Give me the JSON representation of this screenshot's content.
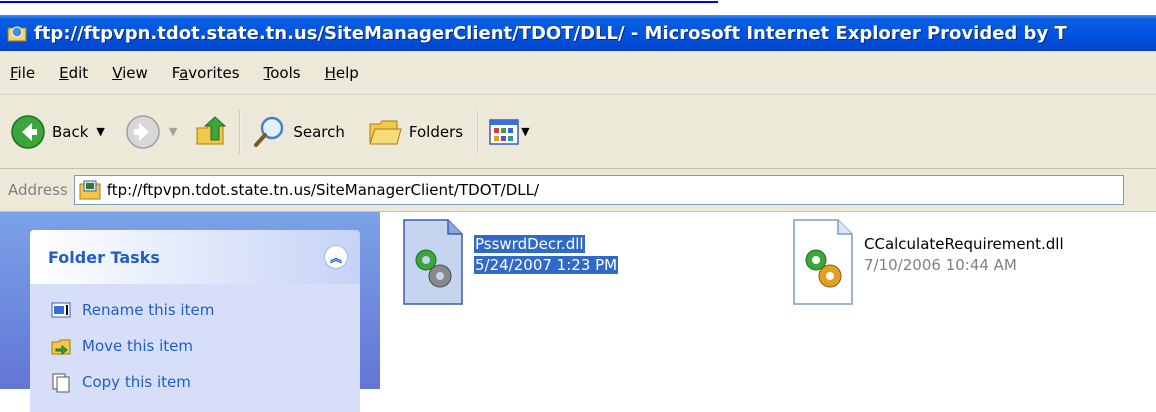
{
  "window": {
    "title": "ftp://ftpvpn.tdot.state.tn.us/SiteManagerClient/TDOT/DLL/ - Microsoft Internet Explorer Provided by T"
  },
  "menu": {
    "items": [
      {
        "label": "File",
        "key": "F"
      },
      {
        "label": "Edit",
        "key": "E"
      },
      {
        "label": "View",
        "key": "V"
      },
      {
        "label": "Favorites",
        "key": "a"
      },
      {
        "label": "Tools",
        "key": "T"
      },
      {
        "label": "Help",
        "key": "H"
      }
    ]
  },
  "toolbar": {
    "back_label": "Back",
    "search_label": "Search",
    "folders_label": "Folders"
  },
  "address": {
    "label": "Address",
    "value": "ftp://ftpvpn.tdot.state.tn.us/SiteManagerClient/TDOT/DLL/"
  },
  "task_pane": {
    "title": "Folder Tasks",
    "items": [
      {
        "label": "Rename this item",
        "icon": "rename-icon"
      },
      {
        "label": "Move this item",
        "icon": "move-icon"
      },
      {
        "label": "Copy this item",
        "icon": "copy-icon"
      }
    ]
  },
  "files": [
    {
      "name": "PsswrdDecr.dll",
      "date": "5/24/2007 1:23 PM",
      "selected": true
    },
    {
      "name": "CCalculateRequirement.dll",
      "date": "7/10/2006 10:44 AM",
      "selected": false
    }
  ],
  "colors": {
    "titlebar": "#0055e5",
    "chrome": "#ece9d8",
    "task_link": "#215dc6",
    "selection": "#316ac5"
  }
}
